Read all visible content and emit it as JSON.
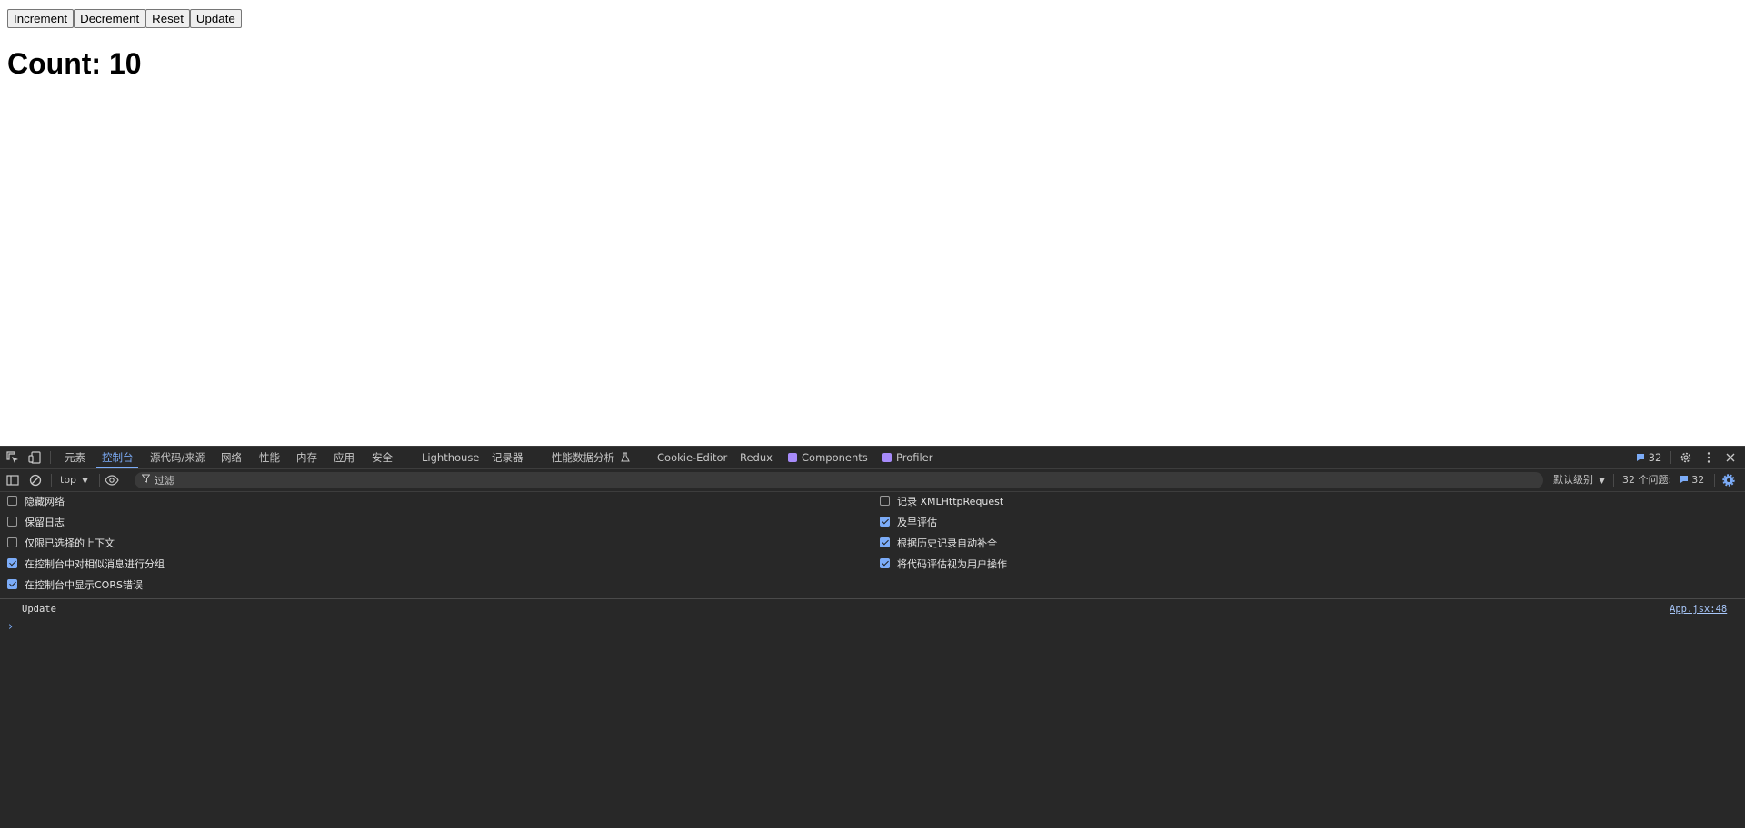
{
  "page": {
    "buttons": {
      "increment": "Increment",
      "decrement": "Decrement",
      "reset": "Reset",
      "update": "Update"
    },
    "count_text": "Count: 10"
  },
  "devtools": {
    "tabs": {
      "elements": "元素",
      "console": "控制台",
      "sources": "源代码/来源",
      "network": "网络",
      "performance": "性能",
      "memory": "内存",
      "application": "应用",
      "security": "安全",
      "lighthouse": "Lighthouse",
      "recorder": "记录器",
      "perf_insights": "性能数据分析",
      "cookie_editor": "Cookie-Editor",
      "redux": "Redux",
      "components": "Components",
      "profiler": "Profiler"
    },
    "issues_badge_count": "32",
    "toolbar": {
      "context": "top",
      "filter_placeholder": "过滤",
      "level": "默认级别",
      "issues_label": "32 个问题:",
      "issues_count": "32"
    },
    "settings_left": [
      {
        "label": "隐藏网络",
        "checked": false
      },
      {
        "label": "保留日志",
        "checked": false
      },
      {
        "label": "仅限已选择的上下文",
        "checked": false
      },
      {
        "label": "在控制台中对相似消息进行分组",
        "checked": true
      },
      {
        "label": "在控制台中显示CORS错误",
        "checked": true
      }
    ],
    "settings_right": [
      {
        "label": "记录 XMLHttpRequest",
        "checked": false
      },
      {
        "label": "及早评估",
        "checked": true
      },
      {
        "label": "根据历史记录自动补全",
        "checked": true
      },
      {
        "label": "将代码评估视为用户操作",
        "checked": true
      }
    ],
    "log": {
      "message": "Update",
      "source": "App.jsx:48",
      "prompt": "›"
    },
    "colors": {
      "background": "#282828",
      "accent": "#7cacf8",
      "text": "#e3e3e3"
    }
  }
}
